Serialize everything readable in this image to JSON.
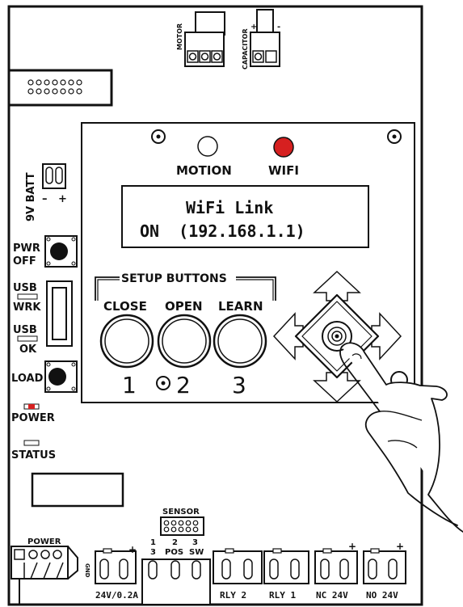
{
  "header_connectors": {
    "motor_label": "MOTOR",
    "capacitor_label": "CAPACITOR",
    "plus": "+",
    "minus": "-"
  },
  "left_panel": {
    "battery_label": "9V BATT",
    "battery_minus": "–",
    "battery_plus": "+",
    "pwr_label_1": "PWR",
    "pwr_label_2": "OFF",
    "usb_wrk_1": "USB",
    "usb_wrk_2": "WRK",
    "usb_ok_1": "USB",
    "usb_ok_2": "OK",
    "load_label": "LOAD",
    "power_led_label": "POWER",
    "status_led_label": "STATUS"
  },
  "display_panel": {
    "motion_label": "MOTION",
    "wifi_label": "WIFI",
    "lcd_line1": "WiFi Link",
    "lcd_line2": "ON  (192.168.1.1)",
    "setup_buttons_label": "SETUP BUTTONS",
    "button_labels": [
      "CLOSE",
      "OPEN",
      "LEARN"
    ],
    "button_numbers": [
      "1",
      "2",
      "3"
    ]
  },
  "bottom_connectors": {
    "sensor_label": "SENSOR",
    "sensor_pin_top": [
      "1",
      "2",
      "3"
    ],
    "sensor_pin_bottom": [
      "3",
      "POS",
      "SW"
    ],
    "power_label": "POWER",
    "gnd_label": "GND",
    "plus": "+",
    "terminal_labels": [
      "24V/0.2A",
      "RLY 2",
      "RLY 1",
      "NC 24V",
      "NO 24V"
    ]
  },
  "colors": {
    "wifi_led": "#d62020",
    "power_led": "#d62020",
    "outline": "#111111"
  }
}
